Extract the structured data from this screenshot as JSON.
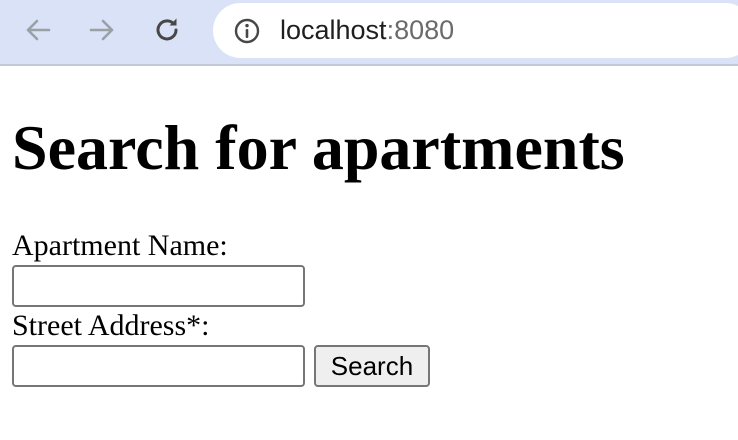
{
  "browser": {
    "url_host": "localhost",
    "url_port": ":8080",
    "icons": {
      "back": "arrow-left-icon",
      "forward": "arrow-right-icon",
      "reload": "reload-icon",
      "site_info": "info-icon"
    }
  },
  "page": {
    "title": "Search for apartments",
    "form": {
      "apartment_name_label": "Apartment Name:",
      "apartment_name_value": "",
      "street_address_label": "Street Address*:",
      "street_address_value": "",
      "search_button_label": "Search"
    }
  },
  "colors": {
    "toolbar_bg": "#d9e2f7",
    "nav_icon": "#9aa0a6",
    "reload_icon": "#474747",
    "url_host": "#1f1f1f",
    "url_port": "#6b6b6b"
  }
}
